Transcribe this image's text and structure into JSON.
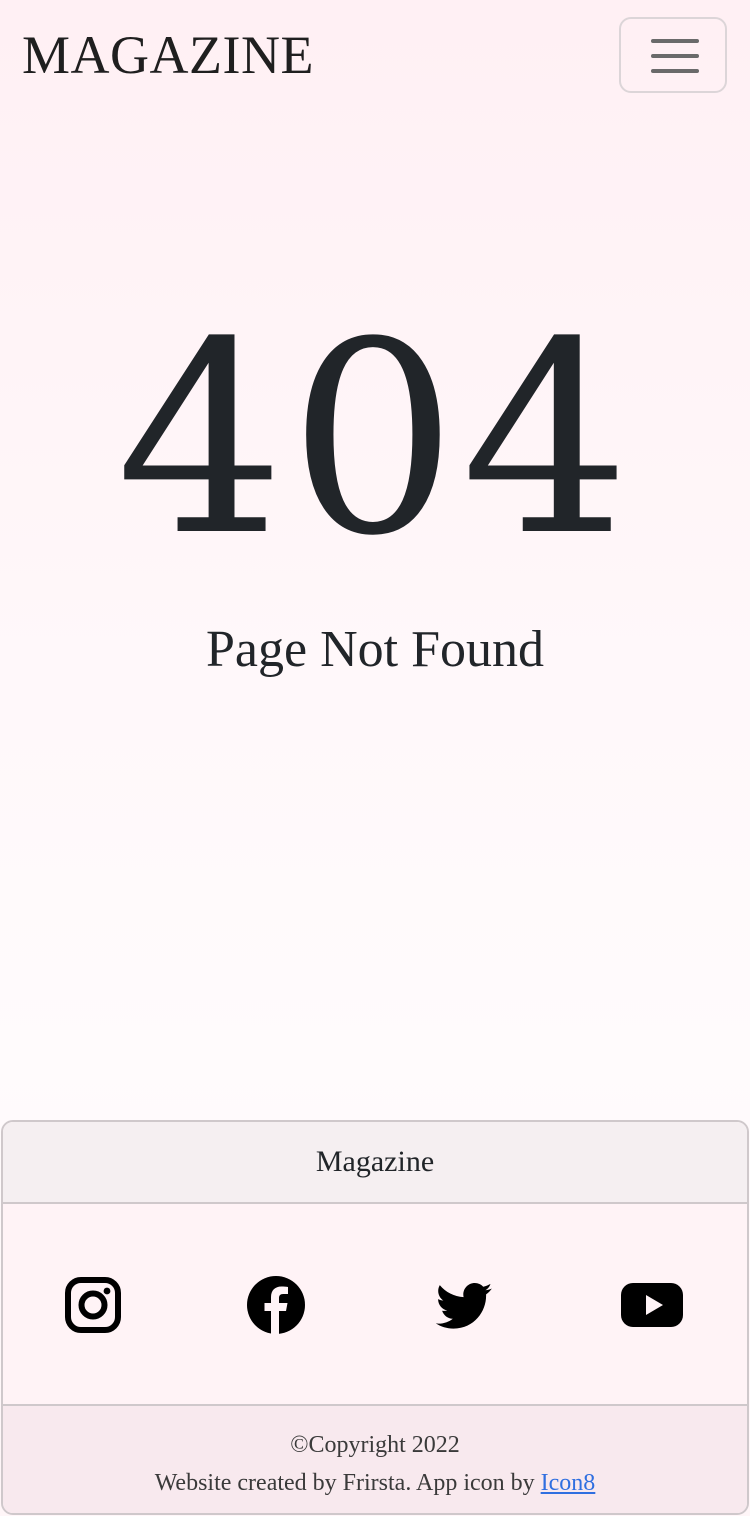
{
  "header": {
    "brand": "MAGAZINE",
    "menu_icon": "hamburger-icon"
  },
  "main": {
    "error_code": "404",
    "error_message": "Page Not Found"
  },
  "footer": {
    "title": "Magazine",
    "social": [
      {
        "name": "Instagram",
        "icon": "instagram-icon"
      },
      {
        "name": "Facebook",
        "icon": "facebook-icon"
      },
      {
        "name": "Twitter",
        "icon": "twitter-icon"
      },
      {
        "name": "YouTube",
        "icon": "youtube-icon"
      }
    ],
    "copyright": "©Copyright 2022",
    "credit_text": "Website created by Frirsta. App icon by ",
    "credit_link": "Icon8",
    "link_color": "#2f6fe0"
  }
}
